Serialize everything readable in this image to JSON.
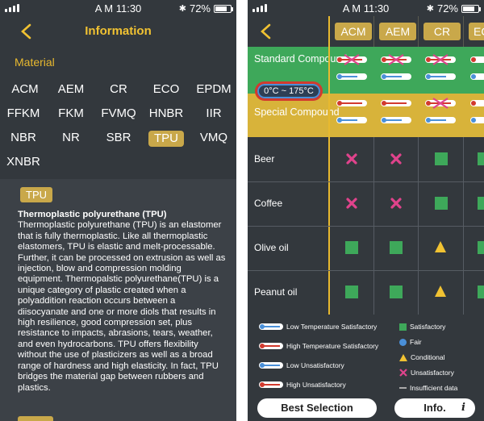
{
  "status": {
    "time": "A M 11:30",
    "battery": "72%"
  },
  "left": {
    "title": "Information",
    "section": "Material",
    "materials": [
      "ACM",
      "AEM",
      "CR",
      "ECO",
      "EPDM",
      "FFKM",
      "FKM",
      "FVMQ",
      "HNBR",
      "IIR",
      "NBR",
      "NR",
      "SBR",
      "TPU",
      "VMQ",
      "XNBR"
    ],
    "selected": "TPU",
    "detail_badge": "TPU",
    "detail_heading": "Thermoplastic polyurethane (TPU)",
    "detail_body": "Thermoplastic polyurethane (TPU) is an elastomer that is fully thermoplastic. Like all thermoplastic elastomers, TPU is elastic and melt-processable. Further, it can be processed on extrusion as well as injection, blow and compression molding equipment. Thermopalstic polyurethane(TPU) is a unique category of plastic created when a polyaddition reaction occurs between a diisocyanate and one or more diols that results in high resilience, good compression set, plus resistance to impacts, abrasions, tears, weather, and even hydrocarbons. TPU offers flexibility without the use of plasticizers as well as a broad range of hardness and high elasticity. In fact, TPU bridges the material gap between rubbers and plastics."
  },
  "right": {
    "columns": [
      "ACM",
      "AEM",
      "CR",
      "EC"
    ],
    "standard_label": "Standard Compound",
    "special_label": "Special Compound",
    "temp_range": "0°C ~ 175°C",
    "rows": [
      {
        "label": "Beer",
        "values": [
          "unsatisfactory",
          "unsatisfactory",
          "satisfactory",
          "satisfactory"
        ]
      },
      {
        "label": "Coffee",
        "values": [
          "unsatisfactory",
          "unsatisfactory",
          "satisfactory",
          "satisfactory"
        ]
      },
      {
        "label": "Olive oil",
        "values": [
          "satisfactory",
          "satisfactory",
          "conditional",
          "satisfactory"
        ]
      },
      {
        "label": "Peanut oil",
        "values": [
          "satisfactory",
          "satisfactory",
          "conditional",
          "satisfactory"
        ]
      }
    ],
    "legend": {
      "low_temp_sat": "Low Temperature Satisfactory",
      "high_temp_sat": "High Temperature Satisfactory",
      "low_unsat": "Low Unsatisfactory",
      "high_unsat": "High Unsatisfactory",
      "satisfactory": "Satisfactory",
      "fair": "Fair",
      "conditional": "Conditional",
      "unsatisfactory": "Unsatisfactory",
      "insufficient": "Insufficient data"
    },
    "best_selection": "Best Selection",
    "info": "Info."
  },
  "colors": {
    "accent": "#f1c232",
    "gold": "#c9a84a",
    "green": "#3ea85a",
    "yellow": "#d8b33a",
    "pink": "#e0438c",
    "blue": "#4a90d9",
    "red": "#d23a2e",
    "bg": "#33383d"
  }
}
